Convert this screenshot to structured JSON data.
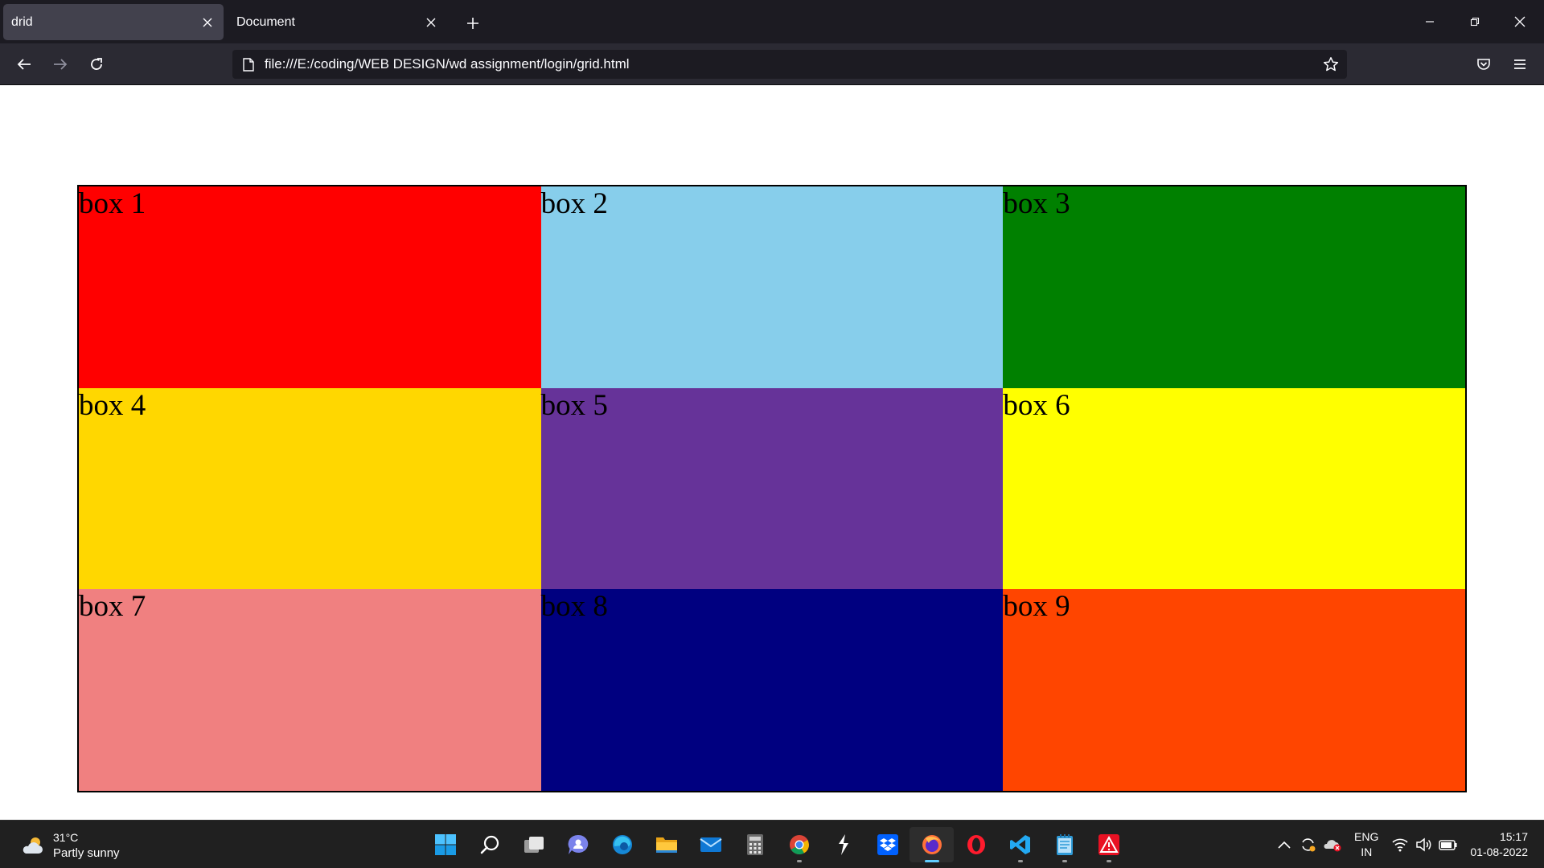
{
  "browser": {
    "tabs": [
      {
        "title": "drid",
        "active": true
      },
      {
        "title": "Document",
        "active": false
      }
    ],
    "url": "file:///E:/coding/WEB DESIGN/wd assignment/login/grid.html"
  },
  "page": {
    "boxes": [
      {
        "label": "box 1",
        "color": "#ff0000"
      },
      {
        "label": "box 2",
        "color": "#87ceeb"
      },
      {
        "label": "box 3",
        "color": "#008000"
      },
      {
        "label": "box 4",
        "color": "#ffd700"
      },
      {
        "label": "box 5",
        "color": "#663399"
      },
      {
        "label": "box 6",
        "color": "#ffff00"
      },
      {
        "label": "box 7",
        "color": "#f08080"
      },
      {
        "label": "box 8",
        "color": "#000080"
      },
      {
        "label": "box 9",
        "color": "#ff4500"
      }
    ]
  },
  "taskbar": {
    "weather": {
      "temp": "31°C",
      "condition": "Partly sunny"
    },
    "apps": [
      {
        "name": "start-icon"
      },
      {
        "name": "search-icon"
      },
      {
        "name": "task-view-icon"
      },
      {
        "name": "chat-icon"
      },
      {
        "name": "edge-icon"
      },
      {
        "name": "file-explorer-icon"
      },
      {
        "name": "mail-icon"
      },
      {
        "name": "calculator-icon"
      },
      {
        "name": "chrome-icon"
      },
      {
        "name": "lightning-app-icon"
      },
      {
        "name": "dropbox-icon"
      },
      {
        "name": "firefox-icon"
      },
      {
        "name": "opera-icon"
      },
      {
        "name": "vscode-icon"
      },
      {
        "name": "notepad-icon"
      },
      {
        "name": "warning-app-icon"
      }
    ],
    "language": {
      "line1": "ENG",
      "line2": "IN"
    },
    "time": "15:17",
    "date": "01-08-2022"
  }
}
